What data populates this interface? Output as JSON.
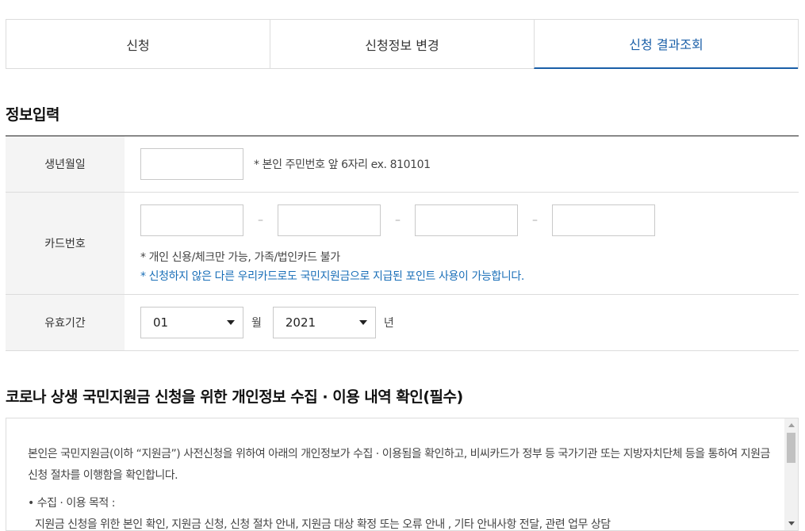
{
  "tabs": [
    {
      "label": "신청",
      "active": false
    },
    {
      "label": "신청정보 변경",
      "active": false
    },
    {
      "label": "신청 결과조회",
      "active": true
    }
  ],
  "info_section": {
    "title": "정보입력",
    "birth": {
      "label": "생년월일",
      "value": "",
      "hint": "* 본인 주민번호 앞 6자리 ex. 810101"
    },
    "card": {
      "label": "카드번호",
      "separator": "–",
      "values": [
        "",
        "",
        "",
        ""
      ],
      "hint1": "* 개인 신용/체크만 가능, 가족/법인카드 불가",
      "hint2": "* 신청하지 않은 다른 우리카드로도 국민지원금으로 지급된 포인트 사용이 가능합니다."
    },
    "expiry": {
      "label": "유효기간",
      "month_value": "01",
      "month_unit": "월",
      "year_value": "2021",
      "year_unit": "년"
    }
  },
  "consent_section": {
    "title": "코로나 상생 국민지원금 신청을 위한 개인정보 수집 · 이용 내역 확인(필수)",
    "intro": "본인은 국민지원금(이하 “지원금”) 사전신청을 위하여 아래의 개인정보가 수집 · 이용됨을 확인하고, 비씨카드가 정부 등 국가기관 또는 지방자치단체 등을 통하여 지원금 신청 절차를 이행함을 확인합니다.",
    "purpose_title": "• 수집 · 이용 목적 :",
    "purpose_text": "지원금 신청을 위한 본인 확인, 지원금 신청, 신청 절차 안내, 지원금 대상 확정 또는 오류 안내 , 기타 안내사항 전달, 관련 업무 상담"
  },
  "colors": {
    "accent": "#1a5fa8",
    "hint_blue": "#1a6fb8",
    "label_bg": "#f4f4f4",
    "border": "#dcdcdc"
  }
}
